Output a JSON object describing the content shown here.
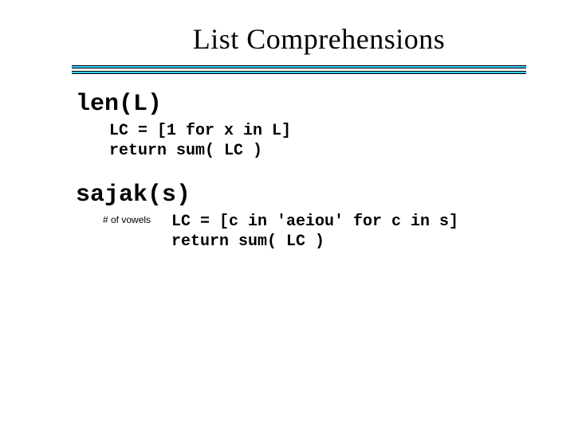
{
  "title": "List Comprehensions",
  "fn1": {
    "name": "len(L)",
    "line1": "LC = [1 for x in L]",
    "line2": "return sum( LC )"
  },
  "fn2": {
    "name": "sajak(s)",
    "note": "# of vowels",
    "line1": "LC = [c in 'aeiou' for c in s]",
    "line2": "return sum( LC )"
  }
}
